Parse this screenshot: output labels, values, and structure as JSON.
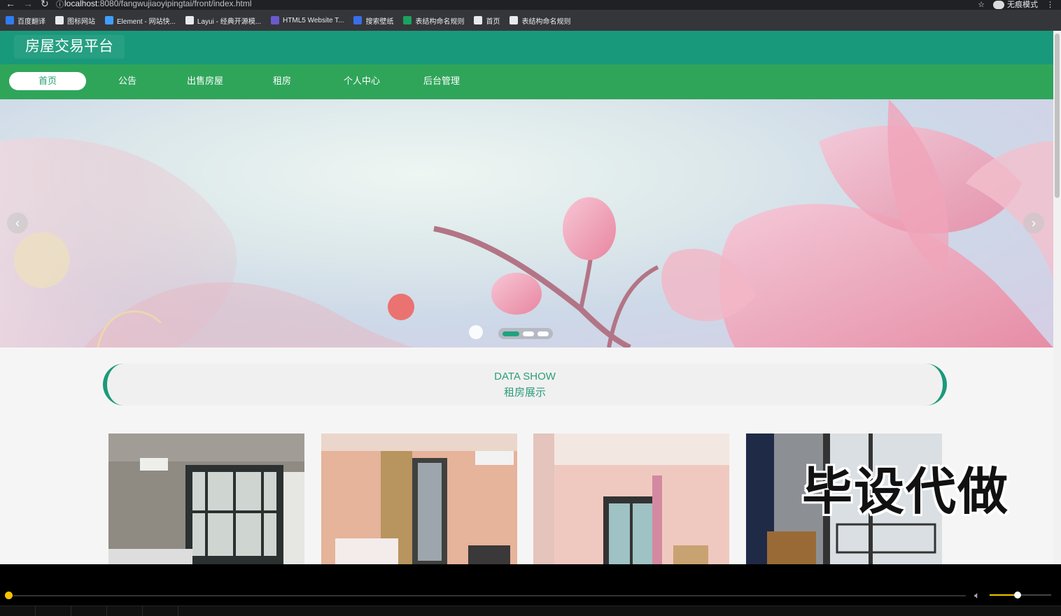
{
  "browser": {
    "url_host": "localhost",
    "url_rest": ":8080/fangwujiaoyipingtai/front/index.html",
    "profile_label": "无痕模式",
    "bookmarks": [
      {
        "label": "百度翻译",
        "icon": "baidu-translate-icon",
        "color": "#2f7df6"
      },
      {
        "label": "图标网站",
        "icon": "flag-icon",
        "color": "#e8eaed"
      },
      {
        "label": "Element - 网站快...",
        "icon": "element-icon",
        "color": "#409eff"
      },
      {
        "label": "Layui - 经典开源模...",
        "icon": "layui-icon",
        "color": "#e8eaed"
      },
      {
        "label": "HTML5 Website T...",
        "icon": "html5-template-icon",
        "color": "#6a5acd"
      },
      {
        "label": "搜索壁纸",
        "icon": "wallpaper-icon",
        "color": "#3a6ee8"
      },
      {
        "label": "表结构命名规则",
        "icon": "doc-icon",
        "color": "#1aa260"
      },
      {
        "label": "首页",
        "icon": "globe-icon",
        "color": "#e8eaed"
      },
      {
        "label": "表结构命名规则",
        "icon": "globe-icon",
        "color": "#e8eaed"
      }
    ]
  },
  "site": {
    "logo": "房屋交易平台",
    "nav": [
      "首页",
      "公告",
      "出售房屋",
      "租房",
      "个人中心",
      "后台管理"
    ],
    "active_nav": 0,
    "colors": {
      "header": "#19997b",
      "navbar": "#2fa55a",
      "accent": "#20a27e"
    }
  },
  "carousel": {
    "slides": 3,
    "active": 0
  },
  "section": {
    "en": "DATA SHOW",
    "cn": "租房展示"
  },
  "listings": [
    {
      "image": "bedroom-photo-1"
    },
    {
      "image": "bedroom-photo-2"
    },
    {
      "image": "bedroom-photo-3"
    },
    {
      "image": "bedroom-photo-4"
    }
  ],
  "watermark": "毕设代做",
  "player": {
    "progress": 0.0,
    "volume": 0.45
  }
}
